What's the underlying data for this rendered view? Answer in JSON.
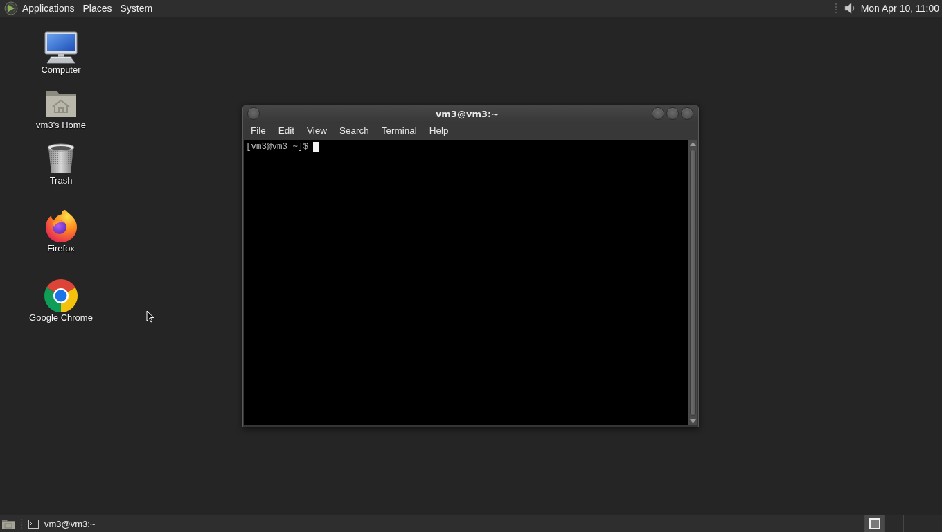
{
  "top_panel": {
    "menus": [
      "Applications",
      "Places",
      "System"
    ],
    "clock": "Mon Apr 10, 11:00"
  },
  "desktop_icons": [
    {
      "label": "Computer",
      "kind": "computer"
    },
    {
      "label": "vm3's Home",
      "kind": "home"
    },
    {
      "label": "Trash",
      "kind": "trash"
    },
    {
      "label": "Firefox",
      "kind": "firefox"
    },
    {
      "label": "Google Chrome",
      "kind": "chrome"
    }
  ],
  "terminal_window": {
    "title": "vm3@vm3:~",
    "menu": [
      "File",
      "Edit",
      "View",
      "Search",
      "Terminal",
      "Help"
    ],
    "prompt": "[vm3@vm3 ~]$"
  },
  "bottom_panel": {
    "tasks": [
      {
        "label": "vm3@vm3:~"
      }
    ],
    "workspaces": [
      {
        "selected": true,
        "has_window": true
      },
      {
        "selected": false,
        "has_window": false
      },
      {
        "selected": false,
        "has_window": false
      },
      {
        "selected": false,
        "has_window": false
      }
    ]
  }
}
